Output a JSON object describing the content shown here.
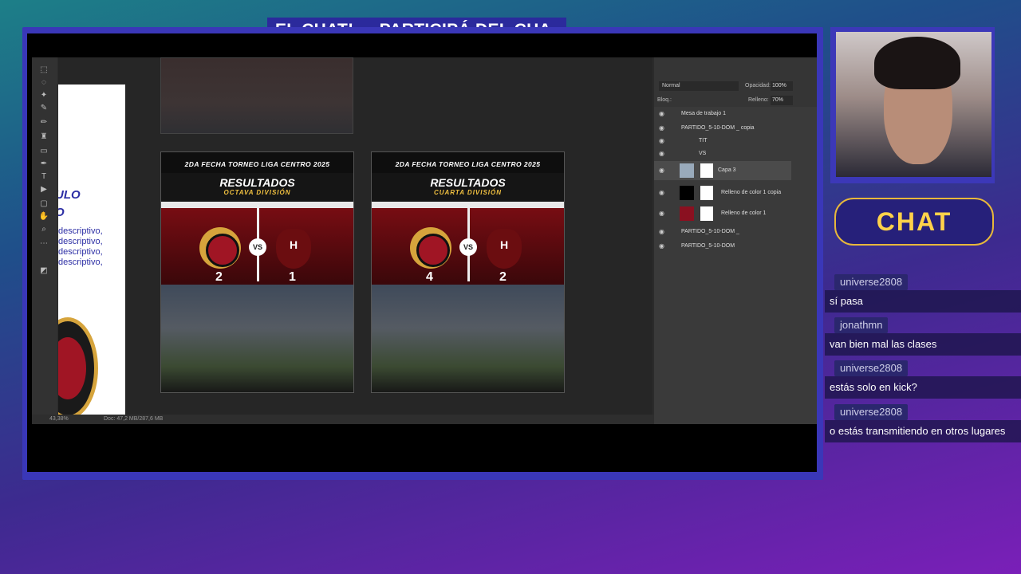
{
  "ticker": [
    "EL CHAT!",
    "PARTICIPÁ DEL CHA"
  ],
  "photoshop": {
    "doc_side_title": [
      "ULO",
      "O"
    ],
    "doc_side_desc": [
      "descriptivo,",
      "descriptivo,",
      "descriptivo,",
      "descriptivo,"
    ],
    "posters": [
      {
        "header": "2DA FECHA TORNEO LIGA CENTRO 2025",
        "title": "RESULTADOS",
        "subtitle": "OCTAVA DIVISIÓN",
        "vs": "VS",
        "score_a": "2",
        "score_b": "1"
      },
      {
        "header": "2DA FECHA TORNEO LIGA CENTRO 2025",
        "title": "RESULTADOS",
        "subtitle": "CUARTA DIVISIÓN",
        "vs": "VS",
        "score_a": "4",
        "score_b": "2"
      }
    ],
    "layers_panel": {
      "blend_mode": "Normal",
      "opacity_label": "Opacidad:",
      "opacity": "100%",
      "fill_label": "Relleno:",
      "fill": "70%",
      "lock_label": "Bloq.:",
      "layers": [
        {
          "name": "Mesa de trabajo 1"
        },
        {
          "name": "PARTIDO_5-10-DOM _ copia"
        },
        {
          "name": "TIT"
        },
        {
          "name": "VS"
        },
        {
          "name": "Capa 3"
        },
        {
          "name": "Relleno de color 1 copia"
        },
        {
          "name": "Relleno de color 1"
        },
        {
          "name": "PARTIDO_5-10-DOM _"
        },
        {
          "name": "PARTIDO_5-10-DOM"
        }
      ]
    },
    "status": {
      "zoom": "43,38%",
      "doc": "Doc: 47,2 MB/287,6 MB"
    }
  },
  "chat": {
    "title": "CHAT",
    "messages": [
      {
        "user": "universe2808",
        "text": "sí pasa"
      },
      {
        "user": "jonathmn",
        "text": "van bien mal las clases"
      },
      {
        "user": "universe2808",
        "text": "estás solo en kick?"
      },
      {
        "user": "universe2808",
        "text": "o estás transmitiendo en otros lugares"
      }
    ]
  }
}
